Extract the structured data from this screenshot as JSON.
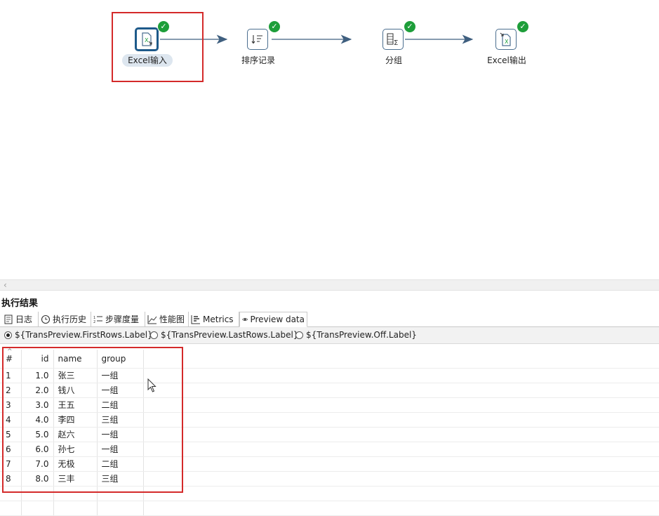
{
  "flow": {
    "nodes": [
      {
        "label": "Excel输入",
        "icon": "excel-input-icon",
        "status": "success"
      },
      {
        "label": "排序记录",
        "icon": "sort-icon",
        "status": "success"
      },
      {
        "label": "分组",
        "icon": "group-by-icon",
        "status": "success"
      },
      {
        "label": "Excel输出",
        "icon": "excel-output-icon",
        "status": "success"
      }
    ],
    "status_glyph": "✓"
  },
  "results": {
    "title": "执行结果",
    "tabs": [
      {
        "label": "日志",
        "icon": "log-icon"
      },
      {
        "label": "执行历史",
        "icon": "history-icon"
      },
      {
        "label": "步骤度量",
        "icon": "step-metrics-icon"
      },
      {
        "label": "性能图",
        "icon": "performance-chart-icon"
      },
      {
        "label": "Metrics",
        "icon": "metrics-icon"
      },
      {
        "label": "Preview data",
        "icon": "eye-icon",
        "active": true
      }
    ],
    "radio_options": [
      {
        "label": "${TransPreview.FirstRows.Label}",
        "checked": true
      },
      {
        "label": "${TransPreview.LastRows.Label}",
        "checked": false
      },
      {
        "label": "${TransPreview.Off.Label}",
        "checked": false
      }
    ],
    "table": {
      "columns": [
        "#",
        "id",
        "name",
        "group"
      ],
      "rows": [
        [
          "1",
          "1.0",
          "张三",
          "一组"
        ],
        [
          "2",
          "2.0",
          "钱八",
          "一组"
        ],
        [
          "3",
          "3.0",
          "王五",
          "二组"
        ],
        [
          "4",
          "4.0",
          "李四",
          "三组"
        ],
        [
          "5",
          "5.0",
          "赵六",
          "一组"
        ],
        [
          "6",
          "6.0",
          "孙七",
          "一组"
        ],
        [
          "7",
          "7.0",
          "无极",
          "二组"
        ],
        [
          "8",
          "8.0",
          "三丰",
          "三组"
        ]
      ]
    }
  },
  "colors": {
    "highlight": "#d42a2a",
    "success": "#1e9e3a",
    "node_border": "#4b6e8f",
    "arrow": "#3f5f7f"
  }
}
